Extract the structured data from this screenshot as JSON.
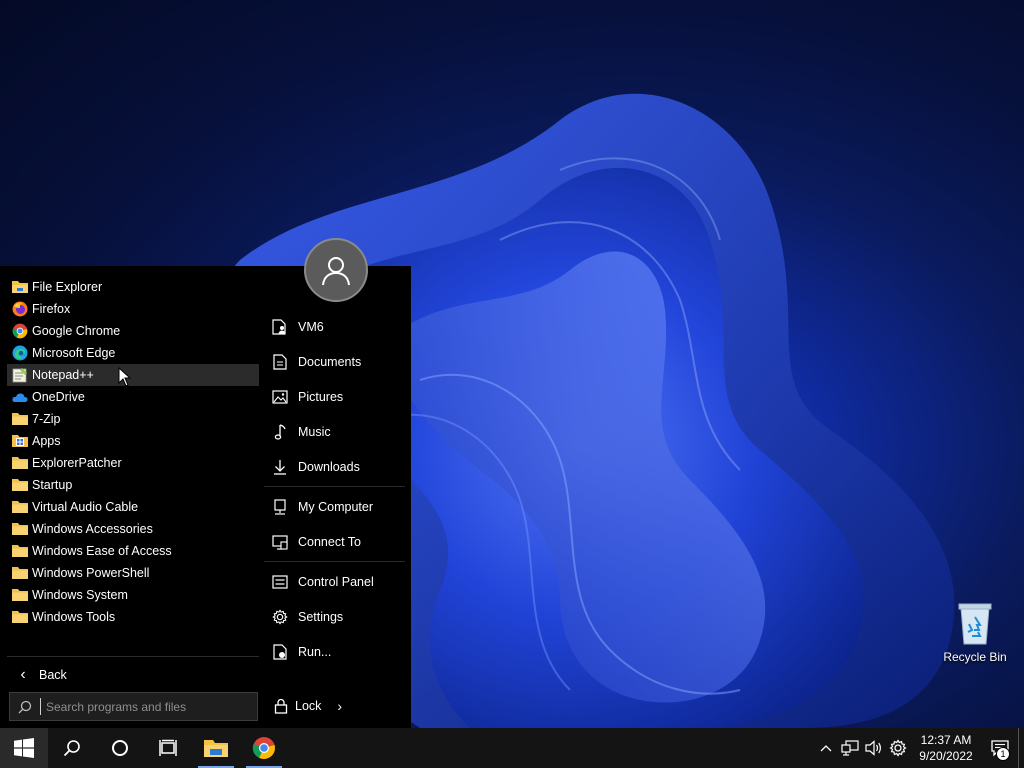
{
  "desktop": {
    "icons": [
      {
        "label": "Recycle Bin",
        "icon": "recycle-bin-icon"
      }
    ]
  },
  "start_menu": {
    "programs": [
      {
        "label": "File Explorer",
        "icon": "file-explorer-icon",
        "color": "#f5c242"
      },
      {
        "label": "Firefox",
        "icon": "firefox-icon",
        "color": "#ff7a1a"
      },
      {
        "label": "Google Chrome",
        "icon": "chrome-icon",
        "color": "#34a853"
      },
      {
        "label": "Microsoft Edge",
        "icon": "edge-icon",
        "color": "#1fa2e0"
      },
      {
        "label": "Notepad++",
        "icon": "notepadpp-icon",
        "color": "#8fcf4a"
      },
      {
        "label": "OneDrive",
        "icon": "onedrive-icon",
        "color": "#2b8be8"
      },
      {
        "label": "7-Zip",
        "icon": "folder-icon",
        "color": "#f3c04c"
      },
      {
        "label": "Apps",
        "icon": "apps-icon",
        "color": "#f3c04c"
      },
      {
        "label": "ExplorerPatcher",
        "icon": "folder-icon",
        "color": "#f3c04c"
      },
      {
        "label": "Startup",
        "icon": "folder-icon",
        "color": "#f3c04c"
      },
      {
        "label": "Virtual Audio Cable",
        "icon": "folder-icon",
        "color": "#f3c04c"
      },
      {
        "label": "Windows Accessories",
        "icon": "folder-icon",
        "color": "#f3c04c"
      },
      {
        "label": "Windows Ease of Access",
        "icon": "folder-icon",
        "color": "#f3c04c"
      },
      {
        "label": "Windows PowerShell",
        "icon": "folder-icon",
        "color": "#f3c04c"
      },
      {
        "label": "Windows System",
        "icon": "folder-icon",
        "color": "#f3c04c"
      },
      {
        "label": "Windows Tools",
        "icon": "folder-icon",
        "color": "#f3c04c"
      }
    ],
    "highlighted_index": 4,
    "back_label": "Back",
    "search_placeholder": "Search programs and files",
    "places": [
      {
        "label": "VM6",
        "icon": "user-folder-icon"
      },
      {
        "label": "Documents",
        "icon": "document-icon"
      },
      {
        "label": "Pictures",
        "icon": "picture-icon"
      },
      {
        "label": "Music",
        "icon": "music-icon"
      },
      {
        "label": "Downloads",
        "icon": "download-icon"
      }
    ],
    "system": [
      {
        "label": "My Computer",
        "icon": "computer-icon"
      },
      {
        "label": "Connect To",
        "icon": "connect-icon"
      }
    ],
    "tools": [
      {
        "label": "Control Panel",
        "icon": "control-panel-icon"
      },
      {
        "label": "Settings",
        "icon": "settings-icon"
      },
      {
        "label": "Run...",
        "icon": "run-icon"
      }
    ],
    "lock_label": "Lock"
  },
  "taskbar": {
    "clock_time": "12:37 AM",
    "clock_date": "9/20/2022",
    "notification_count": "1",
    "run_indicator_color": "#7aa6e8"
  }
}
